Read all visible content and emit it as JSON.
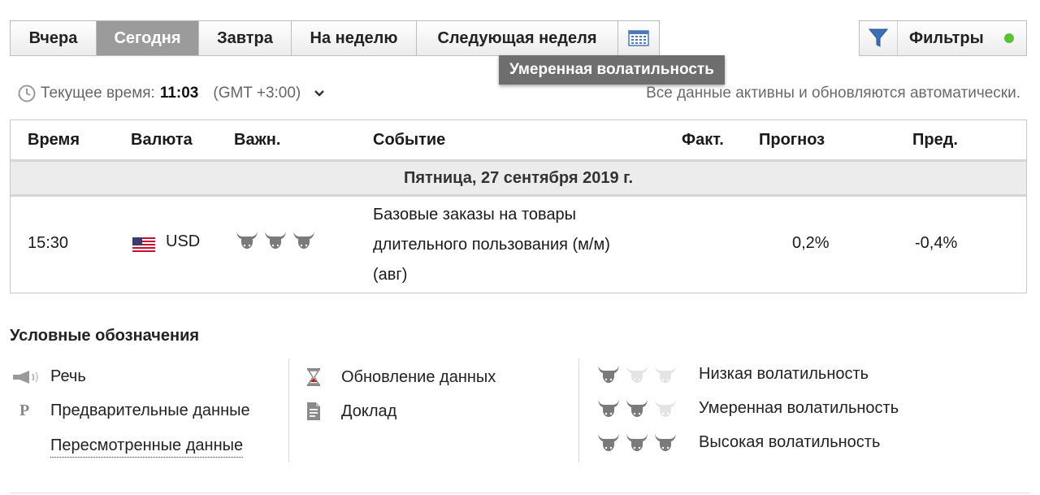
{
  "tabs": [
    {
      "label": "Вчера",
      "active": false
    },
    {
      "label": "Сегодня",
      "active": true
    },
    {
      "label": "Завтра",
      "active": false
    },
    {
      "label": "На неделю",
      "active": false
    },
    {
      "label": "Следующая неделя",
      "active": false
    }
  ],
  "calendar_icon": "calendar-icon",
  "tooltip": "Умеренная волатильность",
  "filters": {
    "label": "Фильтры",
    "icon": "filter-icon",
    "status_color": "#5bc236"
  },
  "time": {
    "label": "Текущее время:",
    "value": "11:03",
    "timezone": "(GMT +3:00)"
  },
  "auto_note": "Все данные активны и обновляются автоматически.",
  "table": {
    "columns": [
      "Время",
      "Валюта",
      "Важн.",
      "Событие",
      "Факт.",
      "Прогноз",
      "Пред."
    ],
    "day": "Пятница, 27 сентября 2019 г.",
    "rows": [
      {
        "time": "15:30",
        "currency": "USD",
        "flag": "us-flag-icon",
        "importance": 3,
        "event_lines": [
          "Базовые заказы на товары",
          "длительного пользования (м/м)",
          "(авг)"
        ],
        "actual": "",
        "forecast": "0,2%",
        "previous": "-0,4%"
      }
    ]
  },
  "legend": {
    "title": "Условные обозначения",
    "col1": [
      "Речь",
      "Предварительные данные",
      "Пересмотренные данные"
    ],
    "col2": [
      "Обновление данных",
      "Доклад"
    ],
    "col3": [
      "Низкая волатильность",
      "Умеренная волатильность",
      "Высокая волатильность"
    ],
    "prelim_mark": "P"
  },
  "colors": {
    "active_tab": "#9b9b9b",
    "bull_on": "#7a7a7a",
    "bull_off": "#e4e4e4",
    "hourglass": "#b3261e"
  }
}
